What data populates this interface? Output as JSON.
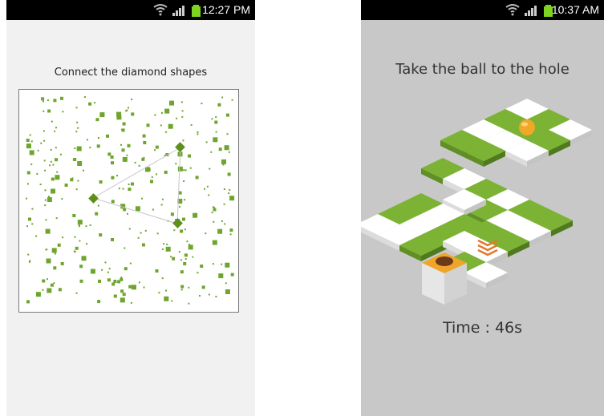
{
  "left_screen": {
    "status_time": "12:27 PM",
    "instruction": "Connect the diamond shapes"
  },
  "right_screen": {
    "status_time": "10:37 AM",
    "instruction": "Take the ball to the hole",
    "timer": "Time : 46s"
  },
  "colors": {
    "accent_green": "#6ea52c",
    "diamond_green": "#5e8f1c",
    "ball_orange": "#f0a828",
    "arrow_orange": "#e8752a",
    "battery_green": "#7fd321"
  },
  "icons": [
    "wifi-icon",
    "signal-icon",
    "battery-icon"
  ]
}
